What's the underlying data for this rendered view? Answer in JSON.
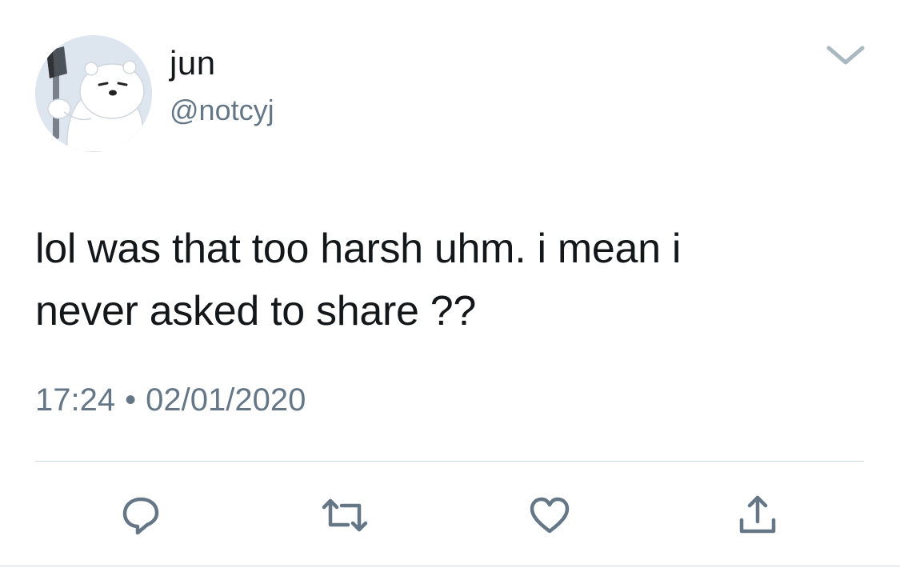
{
  "author": {
    "display_name": "jun",
    "handle": "@notcyj",
    "avatar_icon": "polar-bear-avatar"
  },
  "tweet": {
    "text_line1": "lol was that too harsh uhm. i mean i",
    "text_line2": "never asked to share ??",
    "time": "17:24",
    "separator": "•",
    "date": "02/01/2020"
  },
  "actions": {
    "reply_icon": "reply-icon",
    "retweet_icon": "retweet-icon",
    "like_icon": "heart-icon",
    "share_icon": "share-icon",
    "menu_icon": "chevron-down-icon"
  },
  "colors": {
    "text": "#14171a",
    "secondary": "#657786",
    "icon": "#657786",
    "divider": "#ccd6dd",
    "background": "#ffffff"
  }
}
